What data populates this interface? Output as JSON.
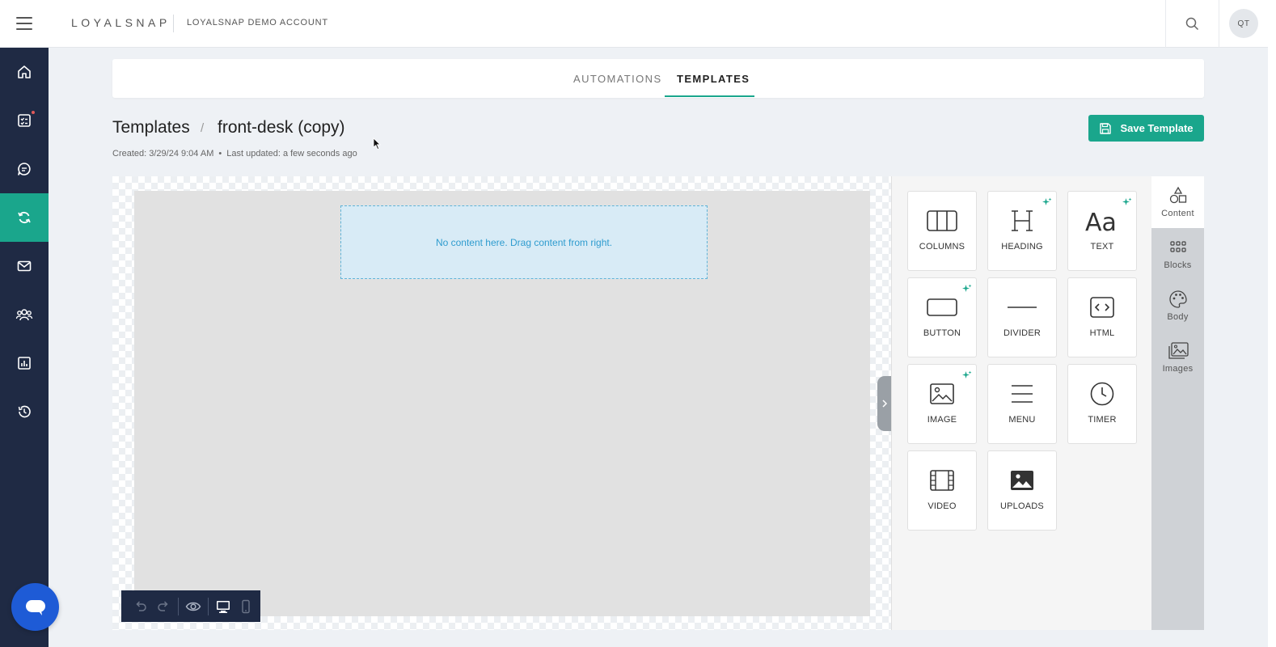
{
  "app": {
    "logo": "LOYALSNAP",
    "account_name": "LOYALSNAP DEMO ACCOUNT",
    "user_initials": "QT"
  },
  "nav": {
    "items": [
      {
        "name": "home",
        "icon": "home-icon"
      },
      {
        "name": "tasks",
        "icon": "checklist-icon",
        "badge": true
      },
      {
        "name": "messages",
        "icon": "chat-icon"
      },
      {
        "name": "automations",
        "icon": "sync-icon",
        "active": true
      },
      {
        "name": "email",
        "icon": "mail-icon"
      },
      {
        "name": "contacts",
        "icon": "group-icon"
      },
      {
        "name": "reports",
        "icon": "bar-chart-icon"
      },
      {
        "name": "history",
        "icon": "history-icon"
      }
    ]
  },
  "tabs": [
    {
      "label": "AUTOMATIONS",
      "active": false
    },
    {
      "label": "TEMPLATES",
      "active": true
    }
  ],
  "header": {
    "breadcrumb_root": "Templates",
    "breadcrumb_sep": "/",
    "breadcrumb_current": "front-desk (copy)",
    "created": "Created: 3/29/24 9:04 AM",
    "meta_sep": "•",
    "updated": "Last updated: a few seconds ago",
    "save_label": "Save Template"
  },
  "editor": {
    "empty_message": "No content here. Drag content from right."
  },
  "content_tools": [
    {
      "label": "COLUMNS",
      "icon": "columns-icon",
      "ai": false
    },
    {
      "label": "HEADING",
      "icon": "heading-icon",
      "ai": true
    },
    {
      "label": "TEXT",
      "icon": "text-icon",
      "ai": true
    },
    {
      "label": "BUTTON",
      "icon": "button-icon",
      "ai": true
    },
    {
      "label": "DIVIDER",
      "icon": "divider-icon",
      "ai": false
    },
    {
      "label": "HTML",
      "icon": "html-icon",
      "ai": false
    },
    {
      "label": "IMAGE",
      "icon": "image-icon",
      "ai": true
    },
    {
      "label": "MENU",
      "icon": "menu-icon",
      "ai": false
    },
    {
      "label": "TIMER",
      "icon": "timer-icon",
      "ai": false
    },
    {
      "label": "VIDEO",
      "icon": "video-icon",
      "ai": false
    },
    {
      "label": "UPLOADS",
      "icon": "uploads-icon",
      "ai": false
    }
  ],
  "side_tabs": [
    {
      "label": "Content",
      "icon": "shapes-icon",
      "active": true
    },
    {
      "label": "Blocks",
      "icon": "grid-icon",
      "active": false
    },
    {
      "label": "Body",
      "icon": "palette-icon",
      "active": false
    },
    {
      "label": "Images",
      "icon": "images-icon",
      "active": false
    }
  ],
  "colors": {
    "accent": "#1aa68c",
    "nav_bg": "#1f2a44",
    "dropzone_bg": "#d8ebf6",
    "dropzone_text": "#2f9ccf",
    "chat_bubble": "#1e5bd6"
  }
}
